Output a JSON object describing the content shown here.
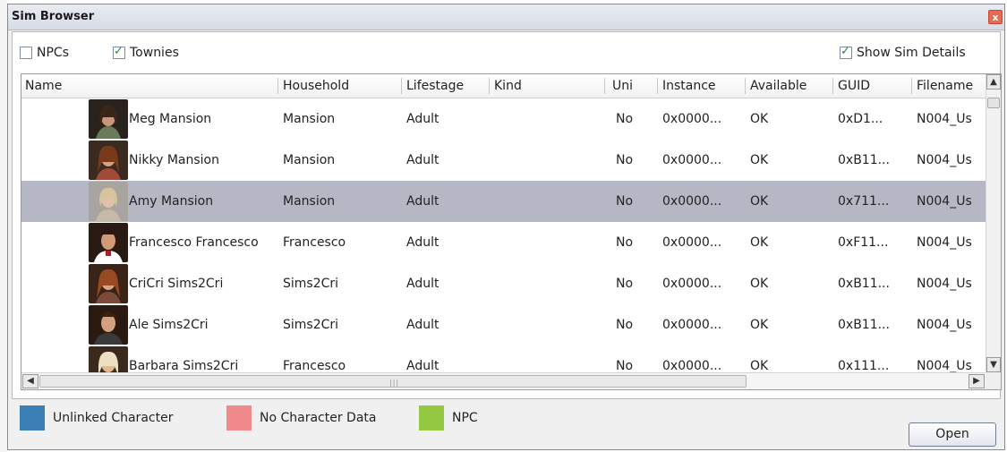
{
  "window": {
    "title": "Sim Browser",
    "close_glyph": "x"
  },
  "filters": {
    "npcs": {
      "label": "NPCs",
      "checked": false
    },
    "townies": {
      "label": "Townies",
      "checked": true
    },
    "show_details": {
      "label": "Show Sim Details",
      "checked": true
    }
  },
  "table": {
    "columns": [
      "Name",
      "Household",
      "Lifestage",
      "Kind",
      "Uni",
      "Instance",
      "Available",
      "GUID",
      "Filename"
    ],
    "rows": [
      {
        "name": "Meg Mansion",
        "household": "Mansion",
        "lifestage": "Adult",
        "kind": "",
        "uni": "No",
        "instance": "0x0000...",
        "available": "OK",
        "guid": "0xD1...",
        "filename": "N004_Us"
      },
      {
        "name": "Nikky Mansion",
        "household": "Mansion",
        "lifestage": "Adult",
        "kind": "",
        "uni": "No",
        "instance": "0x0000...",
        "available": "OK",
        "guid": "0xB11...",
        "filename": "N004_Us"
      },
      {
        "name": "Amy Mansion",
        "household": "Mansion",
        "lifestage": "Adult",
        "kind": "",
        "uni": "No",
        "instance": "0x0000...",
        "available": "OK",
        "guid": "0x711...",
        "filename": "N004_Us",
        "selected": true
      },
      {
        "name": "Francesco Francesco",
        "household": "Francesco",
        "lifestage": "Adult",
        "kind": "",
        "uni": "No",
        "instance": "0x0000...",
        "available": "OK",
        "guid": "0xF11...",
        "filename": "N004_Us"
      },
      {
        "name": "CriCri Sims2Cri",
        "household": "Sims2Cri",
        "lifestage": "Adult",
        "kind": "",
        "uni": "No",
        "instance": "0x0000...",
        "available": "OK",
        "guid": "0xB11...",
        "filename": "N004_Us"
      },
      {
        "name": "Ale Sims2Cri",
        "household": "Sims2Cri",
        "lifestage": "Adult",
        "kind": "",
        "uni": "No",
        "instance": "0x0000...",
        "available": "OK",
        "guid": "0xB11...",
        "filename": "N004_Us"
      },
      {
        "name": "Barbara Sims2Cri",
        "household": "Francesco",
        "lifestage": "Adult",
        "kind": "",
        "uni": "No",
        "instance": "0x0000...",
        "available": "OK",
        "guid": "0x111...",
        "filename": "N004_Us"
      }
    ]
  },
  "legend": [
    {
      "label": "Unlinked Character",
      "color": "#3c7fb7"
    },
    {
      "label": "No Character Data",
      "color": "#f08a8a"
    },
    {
      "label": "NPC",
      "color": "#94c840"
    }
  ],
  "open_label": "Open",
  "colors": {
    "selected_row": "#b5b7c4"
  }
}
